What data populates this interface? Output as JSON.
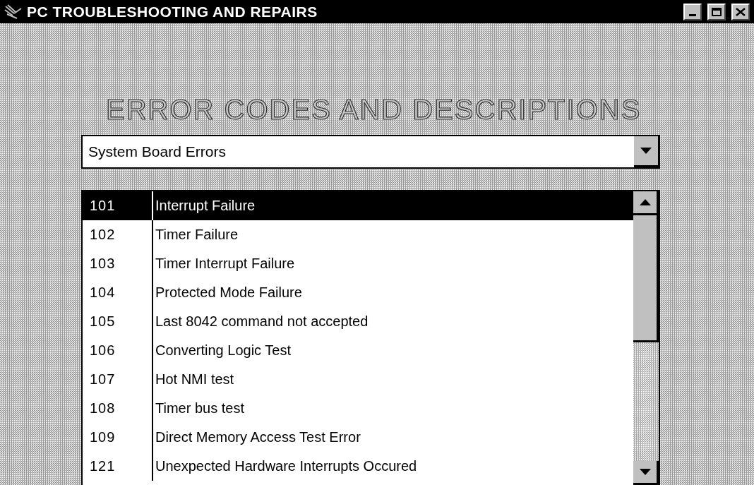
{
  "window": {
    "title": "PC TROUBLESHOOTING AND REPAIRS"
  },
  "heading": "ERROR CODES AND DESCRIPTIONS",
  "category_select": {
    "value": "System Board Errors"
  },
  "error_list": [
    {
      "code": "101",
      "description": "Interrupt Failure",
      "selected": true
    },
    {
      "code": "102",
      "description": "Timer Failure",
      "selected": false
    },
    {
      "code": "103",
      "description": "Timer Interrupt Failure",
      "selected": false
    },
    {
      "code": "104",
      "description": "Protected Mode Failure",
      "selected": false
    },
    {
      "code": "105",
      "description": "Last 8042 command not accepted",
      "selected": false
    },
    {
      "code": "106",
      "description": "Converting Logic Test",
      "selected": false
    },
    {
      "code": "107",
      "description": "Hot NMI test",
      "selected": false
    },
    {
      "code": "108",
      "description": "Timer bus test",
      "selected": false
    },
    {
      "code": "109",
      "description": "Direct Memory Access Test Error",
      "selected": false
    },
    {
      "code": "121",
      "description": " Unexpected Hardware Interrupts Occured",
      "selected": false
    }
  ]
}
